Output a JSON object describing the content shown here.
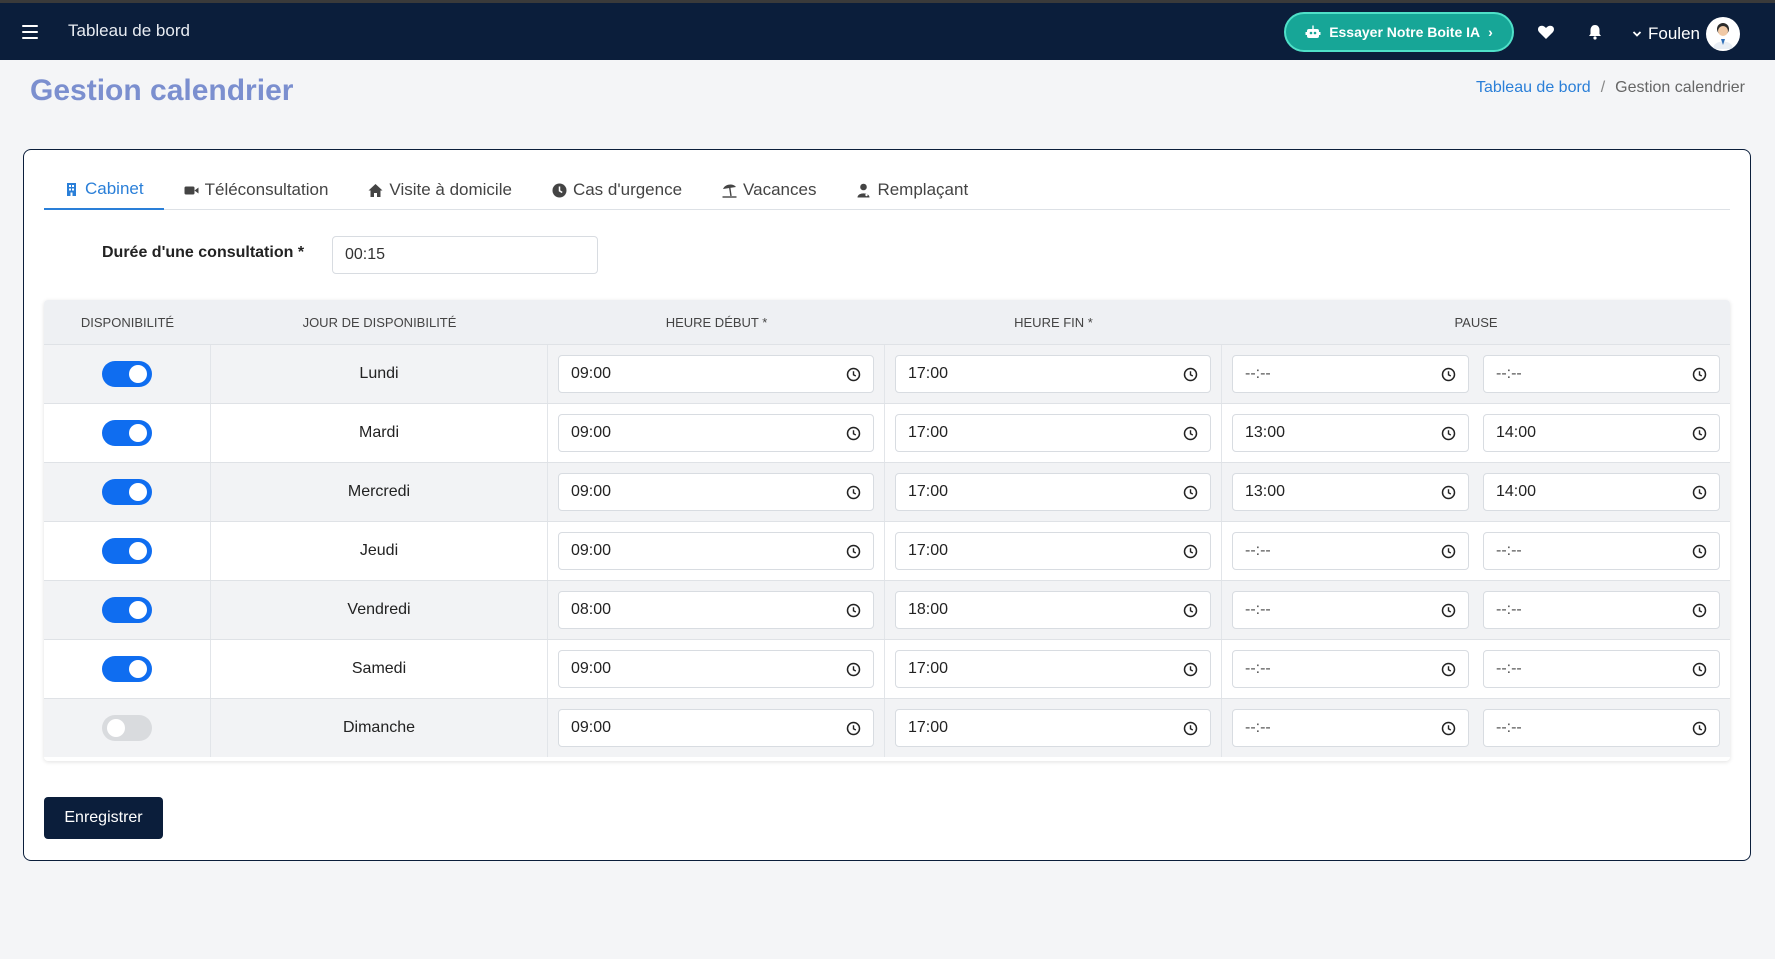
{
  "header": {
    "app_title": "Tableau de bord",
    "ai_button_label": "Essayer Notre Boite IA",
    "ai_button_chevron": "›",
    "user_name": "Foulen"
  },
  "page": {
    "title": "Gestion calendrier",
    "breadcrumb": {
      "link": "Tableau de bord",
      "separator": "/",
      "current": "Gestion calendrier"
    }
  },
  "tabs": [
    {
      "label": "Cabinet",
      "icon": "building-icon",
      "active": true
    },
    {
      "label": "Téléconsultation",
      "icon": "video-icon",
      "active": false
    },
    {
      "label": "Visite à domicile",
      "icon": "home-icon",
      "active": false
    },
    {
      "label": "Cas d'urgence",
      "icon": "clock-icon",
      "active": false
    },
    {
      "label": "Vacances",
      "icon": "umbrella-beach-icon",
      "active": false
    },
    {
      "label": "Remplaçant",
      "icon": "user-doctor-icon",
      "active": false
    }
  ],
  "duration": {
    "label": "Durée d'une consultation *",
    "value": "00:15"
  },
  "table": {
    "headers": [
      "Disponibilité",
      "Jour de disponibilité",
      "Heure Début *",
      "Heure Fin *",
      "Pause"
    ],
    "rows": [
      {
        "available": true,
        "day": "Lundi",
        "start": "09:00",
        "end": "17:00",
        "pause_start": "--:--",
        "pause_end": "--:--"
      },
      {
        "available": true,
        "day": "Mardi",
        "start": "09:00",
        "end": "17:00",
        "pause_start": "13:00",
        "pause_end": "14:00"
      },
      {
        "available": true,
        "day": "Mercredi",
        "start": "09:00",
        "end": "17:00",
        "pause_start": "13:00",
        "pause_end": "14:00"
      },
      {
        "available": true,
        "day": "Jeudi",
        "start": "09:00",
        "end": "17:00",
        "pause_start": "--:--",
        "pause_end": "--:--"
      },
      {
        "available": true,
        "day": "Vendredi",
        "start": "08:00",
        "end": "18:00",
        "pause_start": "--:--",
        "pause_end": "--:--"
      },
      {
        "available": true,
        "day": "Samedi",
        "start": "09:00",
        "end": "17:00",
        "pause_start": "--:--",
        "pause_end": "--:--"
      },
      {
        "available": false,
        "day": "Dimanche",
        "start": "09:00",
        "end": "17:00",
        "pause_start": "--:--",
        "pause_end": "--:--"
      }
    ]
  },
  "actions": {
    "save_label": "Enregistrer"
  },
  "colors": {
    "topbar": "#0b1e3b",
    "accent": "#2a7fd8",
    "title": "#7b8fcf",
    "ai_button": "#17a697",
    "toggle_on": "#0f6df0",
    "toggle_off": "#d9dbde"
  }
}
